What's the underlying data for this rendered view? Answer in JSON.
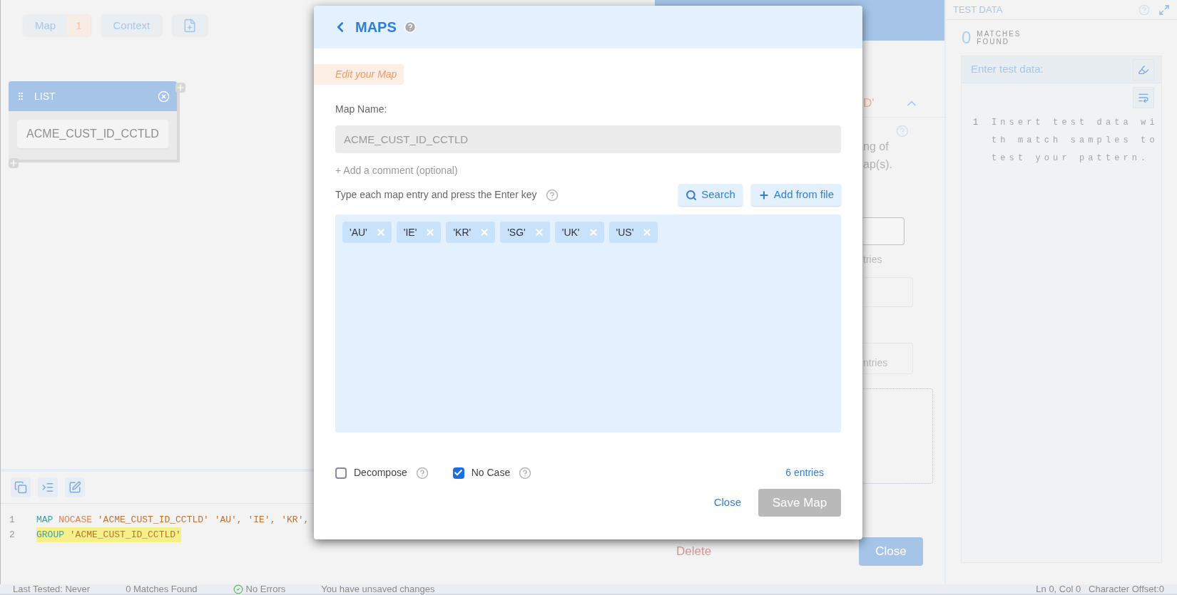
{
  "canvas": {
    "toolbar": [
      {
        "kind": "button",
        "label": "Map",
        "badge": "1"
      },
      {
        "kind": "button",
        "label": "Context"
      },
      {
        "kind": "icon"
      }
    ],
    "node": {
      "title": "LIST",
      "item": "ACME_CUST_ID_CCTLD"
    }
  },
  "editor": {
    "lines": [
      {
        "number": "1",
        "highlighted": false,
        "tokens": [
          {
            "kind": "keyword",
            "text": "MAP"
          },
          {
            "kind": "modifier",
            "text": "NOCASE"
          },
          {
            "kind": "string",
            "text": "'ACME_CUST_ID_CCTLD' 'AU', 'IE', 'KR',"
          }
        ]
      },
      {
        "number": "2",
        "highlighted": true,
        "tokens": [
          {
            "kind": "keyword",
            "text": "GROUP"
          },
          {
            "kind": "string",
            "text": "'ACME_CUST_ID_CCTLD'"
          }
        ]
      }
    ]
  },
  "side_panel": {
    "section_title": "D'",
    "description": [
      "ng of",
      "ap(s)."
    ],
    "entries": [
      "tries",
      "ntries"
    ],
    "delete": "Delete",
    "close": "Close"
  },
  "test_data": {
    "title": "TEST DATA",
    "matches_count": "0",
    "matches_label": "MATCHES FOUND",
    "input_label": "Enter test data:",
    "line_number": "1",
    "placeholder": "Insert test data with match samples to test your pattern."
  },
  "modal": {
    "title": "MAPS",
    "subtitle": "Edit your Map",
    "name_label": "Map Name:",
    "name_value": "ACME_CUST_ID_CCTLD",
    "comment_link": "+ Add a comment (optional)",
    "entry_hint": "Type each map entry and press the Enter key",
    "buttons": [
      {
        "kind": "search",
        "label": "Search"
      },
      {
        "kind": "add",
        "label": "Add from file"
      }
    ],
    "entries": [
      "'AU'",
      "'IE'",
      "'KR'",
      "'SG'",
      "'UK'",
      "'US'"
    ],
    "options": [
      {
        "label": "Decompose",
        "checked": false
      },
      {
        "label": "No Case",
        "checked": true
      }
    ],
    "count": "6 entries",
    "close": "Close",
    "save": {
      "label": "Save Map",
      "disabled": true
    }
  },
  "status_bar": {
    "items": [
      {
        "kind": "text",
        "text": "Last Tested: Never"
      },
      {
        "kind": "text",
        "text": "0 Matches Found"
      },
      {
        "kind": "ok",
        "text": "No Errors"
      },
      {
        "kind": "text",
        "text": "You have unsaved changes"
      }
    ],
    "position": "Ln 0, Col 0   Character Offset:0"
  }
}
